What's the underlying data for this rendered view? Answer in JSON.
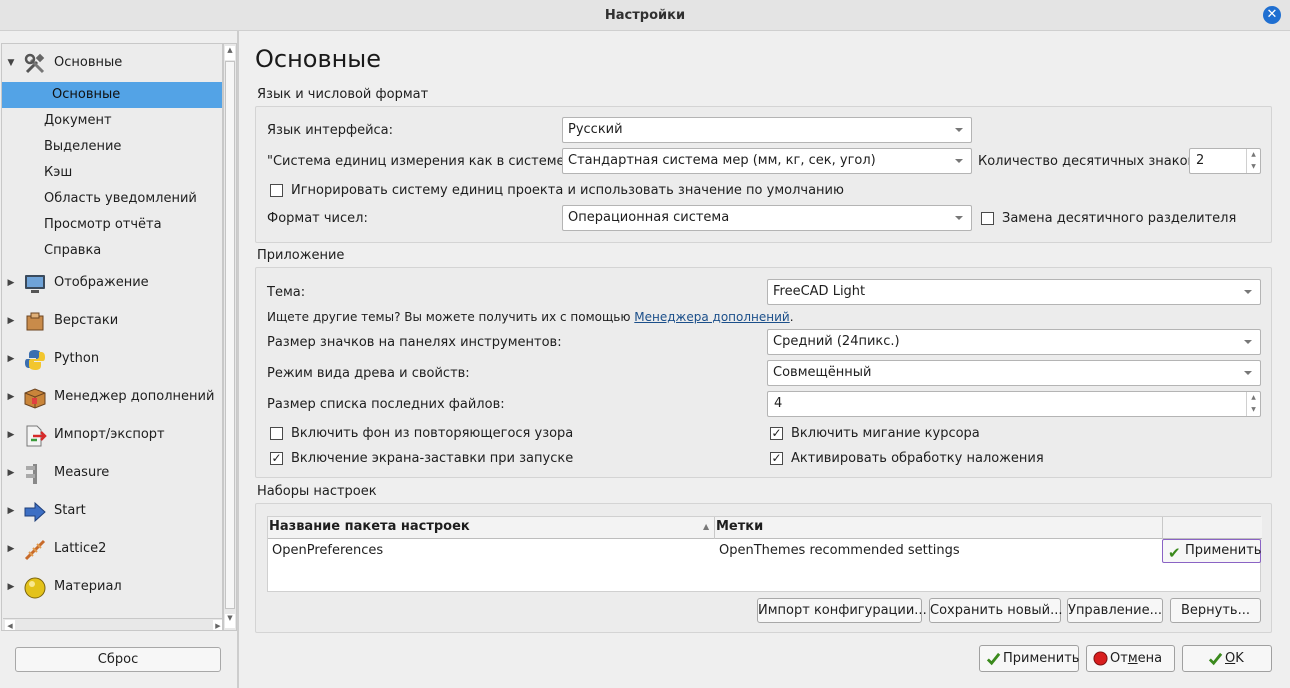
{
  "window": {
    "title": "Настройки"
  },
  "sidebar": {
    "groups": [
      {
        "label": "Основные",
        "expanded": true,
        "icon": "tools-icon"
      },
      {
        "label": "Отображение",
        "icon": "monitor-icon"
      },
      {
        "label": "Верстаки",
        "icon": "workbench-icon"
      },
      {
        "label": "Python",
        "icon": "python-icon"
      },
      {
        "label": "Менеджер дополнений",
        "icon": "addon-box-icon"
      },
      {
        "label": "Импорт/экспорт",
        "icon": "import-export-icon"
      },
      {
        "label": "Measure",
        "icon": "caliper-icon"
      },
      {
        "label": "Start",
        "icon": "arrow-right-icon"
      },
      {
        "label": "Lattice2",
        "icon": "lattice-icon"
      },
      {
        "label": "Материал",
        "icon": "material-sphere-icon"
      }
    ],
    "children": [
      "Основные",
      "Документ",
      "Выделение",
      "Кэш",
      "Область уведомлений",
      "Просмотр отчёта",
      "Справка"
    ],
    "selected_child": "Основные",
    "reset_label": "Сброс"
  },
  "main": {
    "page_title": "Основные",
    "language_group": {
      "title": "Язык и числовой формат",
      "ui_language_label": "Язык интерфейса:",
      "ui_language_value": "Русский",
      "unit_system_label": "\"Система единиц измерения как в системе:\":",
      "unit_system_value": "Стандартная система мер (мм, кг, сек, угол)",
      "decimals_label": "Количество десятичных знаков:",
      "decimals_value": "2",
      "ignore_units_label": "Игнорировать систему единиц проекта и использовать значение по умолчанию",
      "ignore_units_checked": false,
      "number_format_label": "Формат чисел:",
      "number_format_value": "Операционная система",
      "replace_separator_label": "Замена десятичного разделителя",
      "replace_separator_checked": false
    },
    "app_group": {
      "title": "Приложение",
      "theme_label": "Тема:",
      "theme_value": "FreeCAD Light",
      "themes_hint_prefix": "Ищете другие темы? Вы можете получить их с помощью",
      "themes_hint_link": "Менеджера дополнений",
      "themes_hint_suffix": ".",
      "icon_size_label": "Размер значков на панелях инструментов:",
      "icon_size_value": "Средний (24пикс.)",
      "tree_mode_label": "Режим вида древа и свойств:",
      "tree_mode_value": "Совмещённый",
      "recent_files_label": "Размер списка последних файлов:",
      "recent_files_value": "4",
      "tiled_bg_label": "Включить фон из повторяющегося узора",
      "tiled_bg_checked": false,
      "cursor_blink_label": "Включить мигание курсора",
      "cursor_blink_checked": true,
      "splash_label": "Включение экрана-заставки при запуске",
      "splash_checked": true,
      "overlay_label": "Активировать обработку наложения",
      "overlay_checked": true
    },
    "packs_group": {
      "title": "Наборы настроек",
      "col_name": "Название пакета настроек",
      "col_tags": "Метки",
      "rows": [
        {
          "name": "OpenPreferences",
          "tags": "OpenThemes recommended settings",
          "action": "Применить"
        }
      ],
      "import_label": "Импорт конфигурации...",
      "save_new_label": "Сохранить новый...",
      "manage_label": "Управление...",
      "revert_label": "Вернуть..."
    }
  },
  "dialog_buttons": {
    "apply": "Применить",
    "cancel_prefix": "От",
    "cancel_underline": "м",
    "cancel_suffix": "ена",
    "ok_underline": "O",
    "ok_suffix": "K"
  },
  "colors": {
    "selection": "#53a3e6",
    "link": "#1b4f8a",
    "close": "#1f6fd1"
  }
}
